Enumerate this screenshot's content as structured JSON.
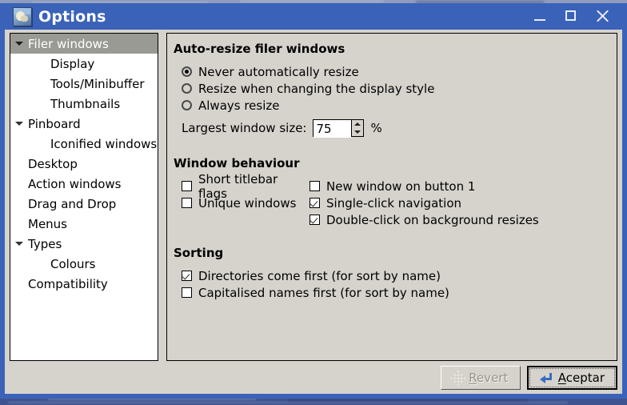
{
  "window": {
    "title": "Options",
    "icon": "image-preview-icon",
    "controls": {
      "minimize": "minimize-icon",
      "maximize": "maximize-icon",
      "close": "close-icon"
    }
  },
  "sidebar": {
    "items": [
      {
        "label": "Filer windows",
        "level": 0,
        "expandable": true,
        "selected": true
      },
      {
        "label": "Display",
        "level": 1,
        "expandable": false,
        "selected": false
      },
      {
        "label": "Tools/Minibuffer",
        "level": 1,
        "expandable": false,
        "selected": false
      },
      {
        "label": "Thumbnails",
        "level": 1,
        "expandable": false,
        "selected": false
      },
      {
        "label": "Pinboard",
        "level": 0,
        "expandable": true,
        "selected": false
      },
      {
        "label": "Iconified windows",
        "level": 1,
        "expandable": false,
        "selected": false
      },
      {
        "label": "Desktop",
        "level": 0,
        "expandable": false,
        "selected": false
      },
      {
        "label": "Action windows",
        "level": 0,
        "expandable": false,
        "selected": false
      },
      {
        "label": "Drag and Drop",
        "level": 0,
        "expandable": false,
        "selected": false
      },
      {
        "label": "Menus",
        "level": 0,
        "expandable": false,
        "selected": false
      },
      {
        "label": "Types",
        "level": 0,
        "expandable": true,
        "selected": false
      },
      {
        "label": "Colours",
        "level": 1,
        "expandable": false,
        "selected": false
      },
      {
        "label": "Compatibility",
        "level": 0,
        "expandable": false,
        "selected": false
      }
    ]
  },
  "panel": {
    "autoresize": {
      "title": "Auto-resize filer windows",
      "options": [
        {
          "label": "Never automatically resize",
          "selected": true
        },
        {
          "label": "Resize when changing the display style",
          "selected": false
        },
        {
          "label": "Always resize",
          "selected": false
        }
      ],
      "largest_label": "Largest window size:",
      "largest_value": "75",
      "largest_unit": "%"
    },
    "window_behaviour": {
      "title": "Window behaviour",
      "left_column": [
        {
          "label": "Short titlebar flags",
          "checked": false
        },
        {
          "label": "Unique windows",
          "checked": false
        }
      ],
      "right_column": [
        {
          "label": "New window on button 1",
          "checked": false
        },
        {
          "label": "Single-click navigation",
          "checked": true
        },
        {
          "label": "Double-click on background resizes",
          "checked": true
        }
      ]
    },
    "sorting": {
      "title": "Sorting",
      "options": [
        {
          "label": "Directories come first (for sort by name)",
          "checked": true
        },
        {
          "label": "Capitalised names first (for sort by name)",
          "checked": false
        }
      ]
    }
  },
  "buttons": {
    "revert": {
      "label_pre": "",
      "accel": "R",
      "label_post": "evert",
      "enabled": false,
      "icon": "revert-icon"
    },
    "accept": {
      "label_pre": "",
      "accel": "A",
      "label_post": "ceptar",
      "enabled": true,
      "default": true,
      "icon": "enter-key-icon"
    }
  },
  "colors": {
    "titlebar": "#3a62b8",
    "face": "#d6d3cd",
    "selection": "#9a9a94",
    "accent": "#3a6cc0"
  }
}
